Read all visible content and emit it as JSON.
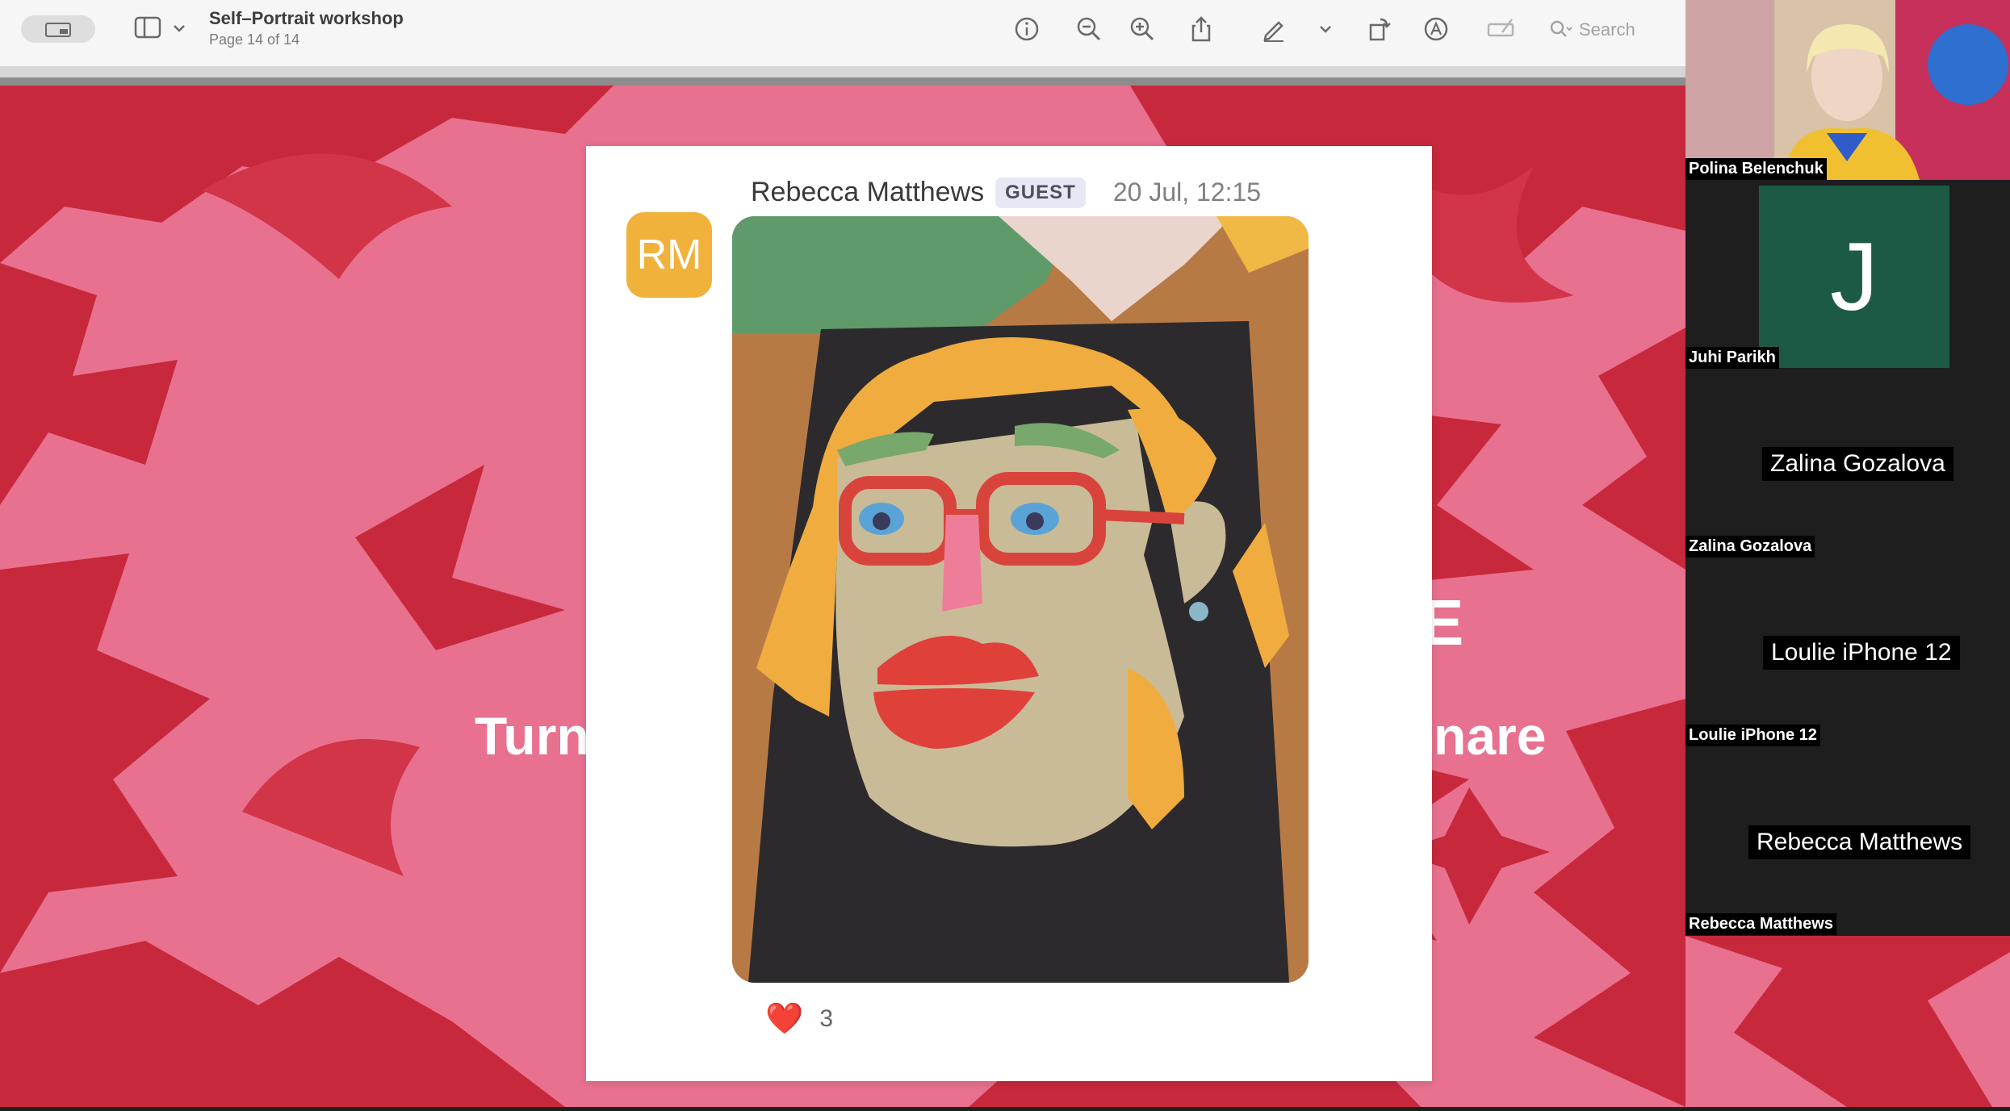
{
  "toolbar": {
    "title": "Self–Portrait workshop",
    "page_info": "Page 14 of 14",
    "search_placeholder": "Search"
  },
  "slide": {
    "text_fragment_left": "Turn",
    "text_fragment_right": "nare",
    "text_fragment_right_top": "E"
  },
  "message": {
    "avatar_initials": "RM",
    "author": "Rebecca Matthews",
    "role_badge": "GUEST",
    "timestamp": "20 Jul, 12:15",
    "reaction_emoji": "❤️",
    "reaction_count": "3"
  },
  "participants": [
    {
      "name": "Polina Belenchuk",
      "has_video": true
    },
    {
      "name": "Juhi Parikh",
      "initial": "J"
    },
    {
      "name": "Zalina Gozalova",
      "display_name": "Zalina Gozalova"
    },
    {
      "name": "Loulie iPhone 12",
      "display_name": "Loulie iPhone 12"
    },
    {
      "name": "Rebecca Matthews",
      "display_name": "Rebecca Matthews"
    }
  ],
  "colors": {
    "avatar": "#f0b23b",
    "slide_pink": "#e8718f",
    "slide_red": "#c8283c",
    "juhi_tile": "#1d5a45"
  }
}
